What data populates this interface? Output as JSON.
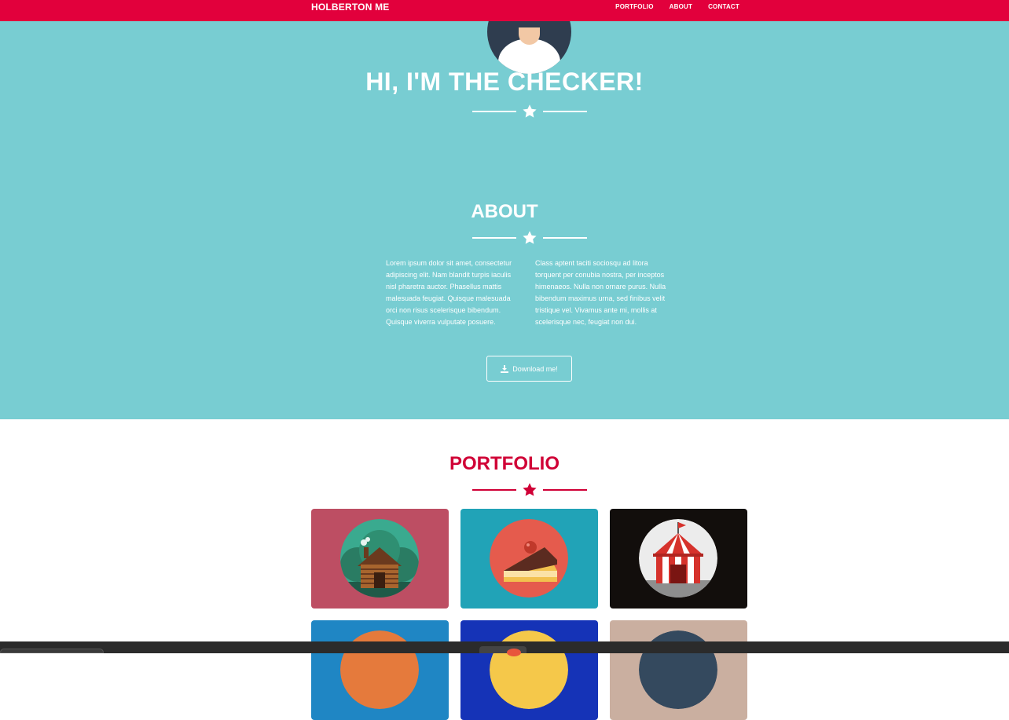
{
  "navbar": {
    "brand": "HOLBERTON ME",
    "links": [
      "PORTFOLIO",
      "ABOUT",
      "CONTACT"
    ],
    "bg_color": "#e2003c"
  },
  "hero": {
    "title": "HI, I'M THE CHECKER!",
    "bg_color": "#78cdd2"
  },
  "about": {
    "title": "ABOUT",
    "col_left": "Lorem ipsum dolor sit amet, consectetur adipiscing elit. Nam blandit turpis iaculis nisl pharetra auctor. Phasellus mattis malesuada feugiat. Quisque malesuada orci non risus scelerisque bibendum. Quisque viverra vulputate posuere.",
    "col_right": "Class aptent taciti sociosqu ad litora torquent per conubia nostra, per inceptos himenaeos. Nulla non ornare purus. Nulla bibendum maximus urna, sed finibus velit tristique vel. Vivamus ante mi, mollis at scelerisque nec, feugiat non dui.",
    "download_label": "Download me!",
    "download_icon": "download-icon"
  },
  "portfolio": {
    "title": "PORTFOLIO",
    "accent_color": "#d00036",
    "items": [
      {
        "icon": "cabin-icon",
        "bg": "#bd4e63"
      },
      {
        "icon": "cake-icon",
        "bg": "#21a3b7"
      },
      {
        "icon": "circus-tent-icon",
        "bg": "#120e0c"
      },
      {
        "icon": "game-controller-icon",
        "bg": "#1f86c4"
      },
      {
        "icon": "safe-icon",
        "bg": "#1533b7"
      },
      {
        "icon": "submarine-icon",
        "bg": "#caafa0"
      }
    ]
  }
}
